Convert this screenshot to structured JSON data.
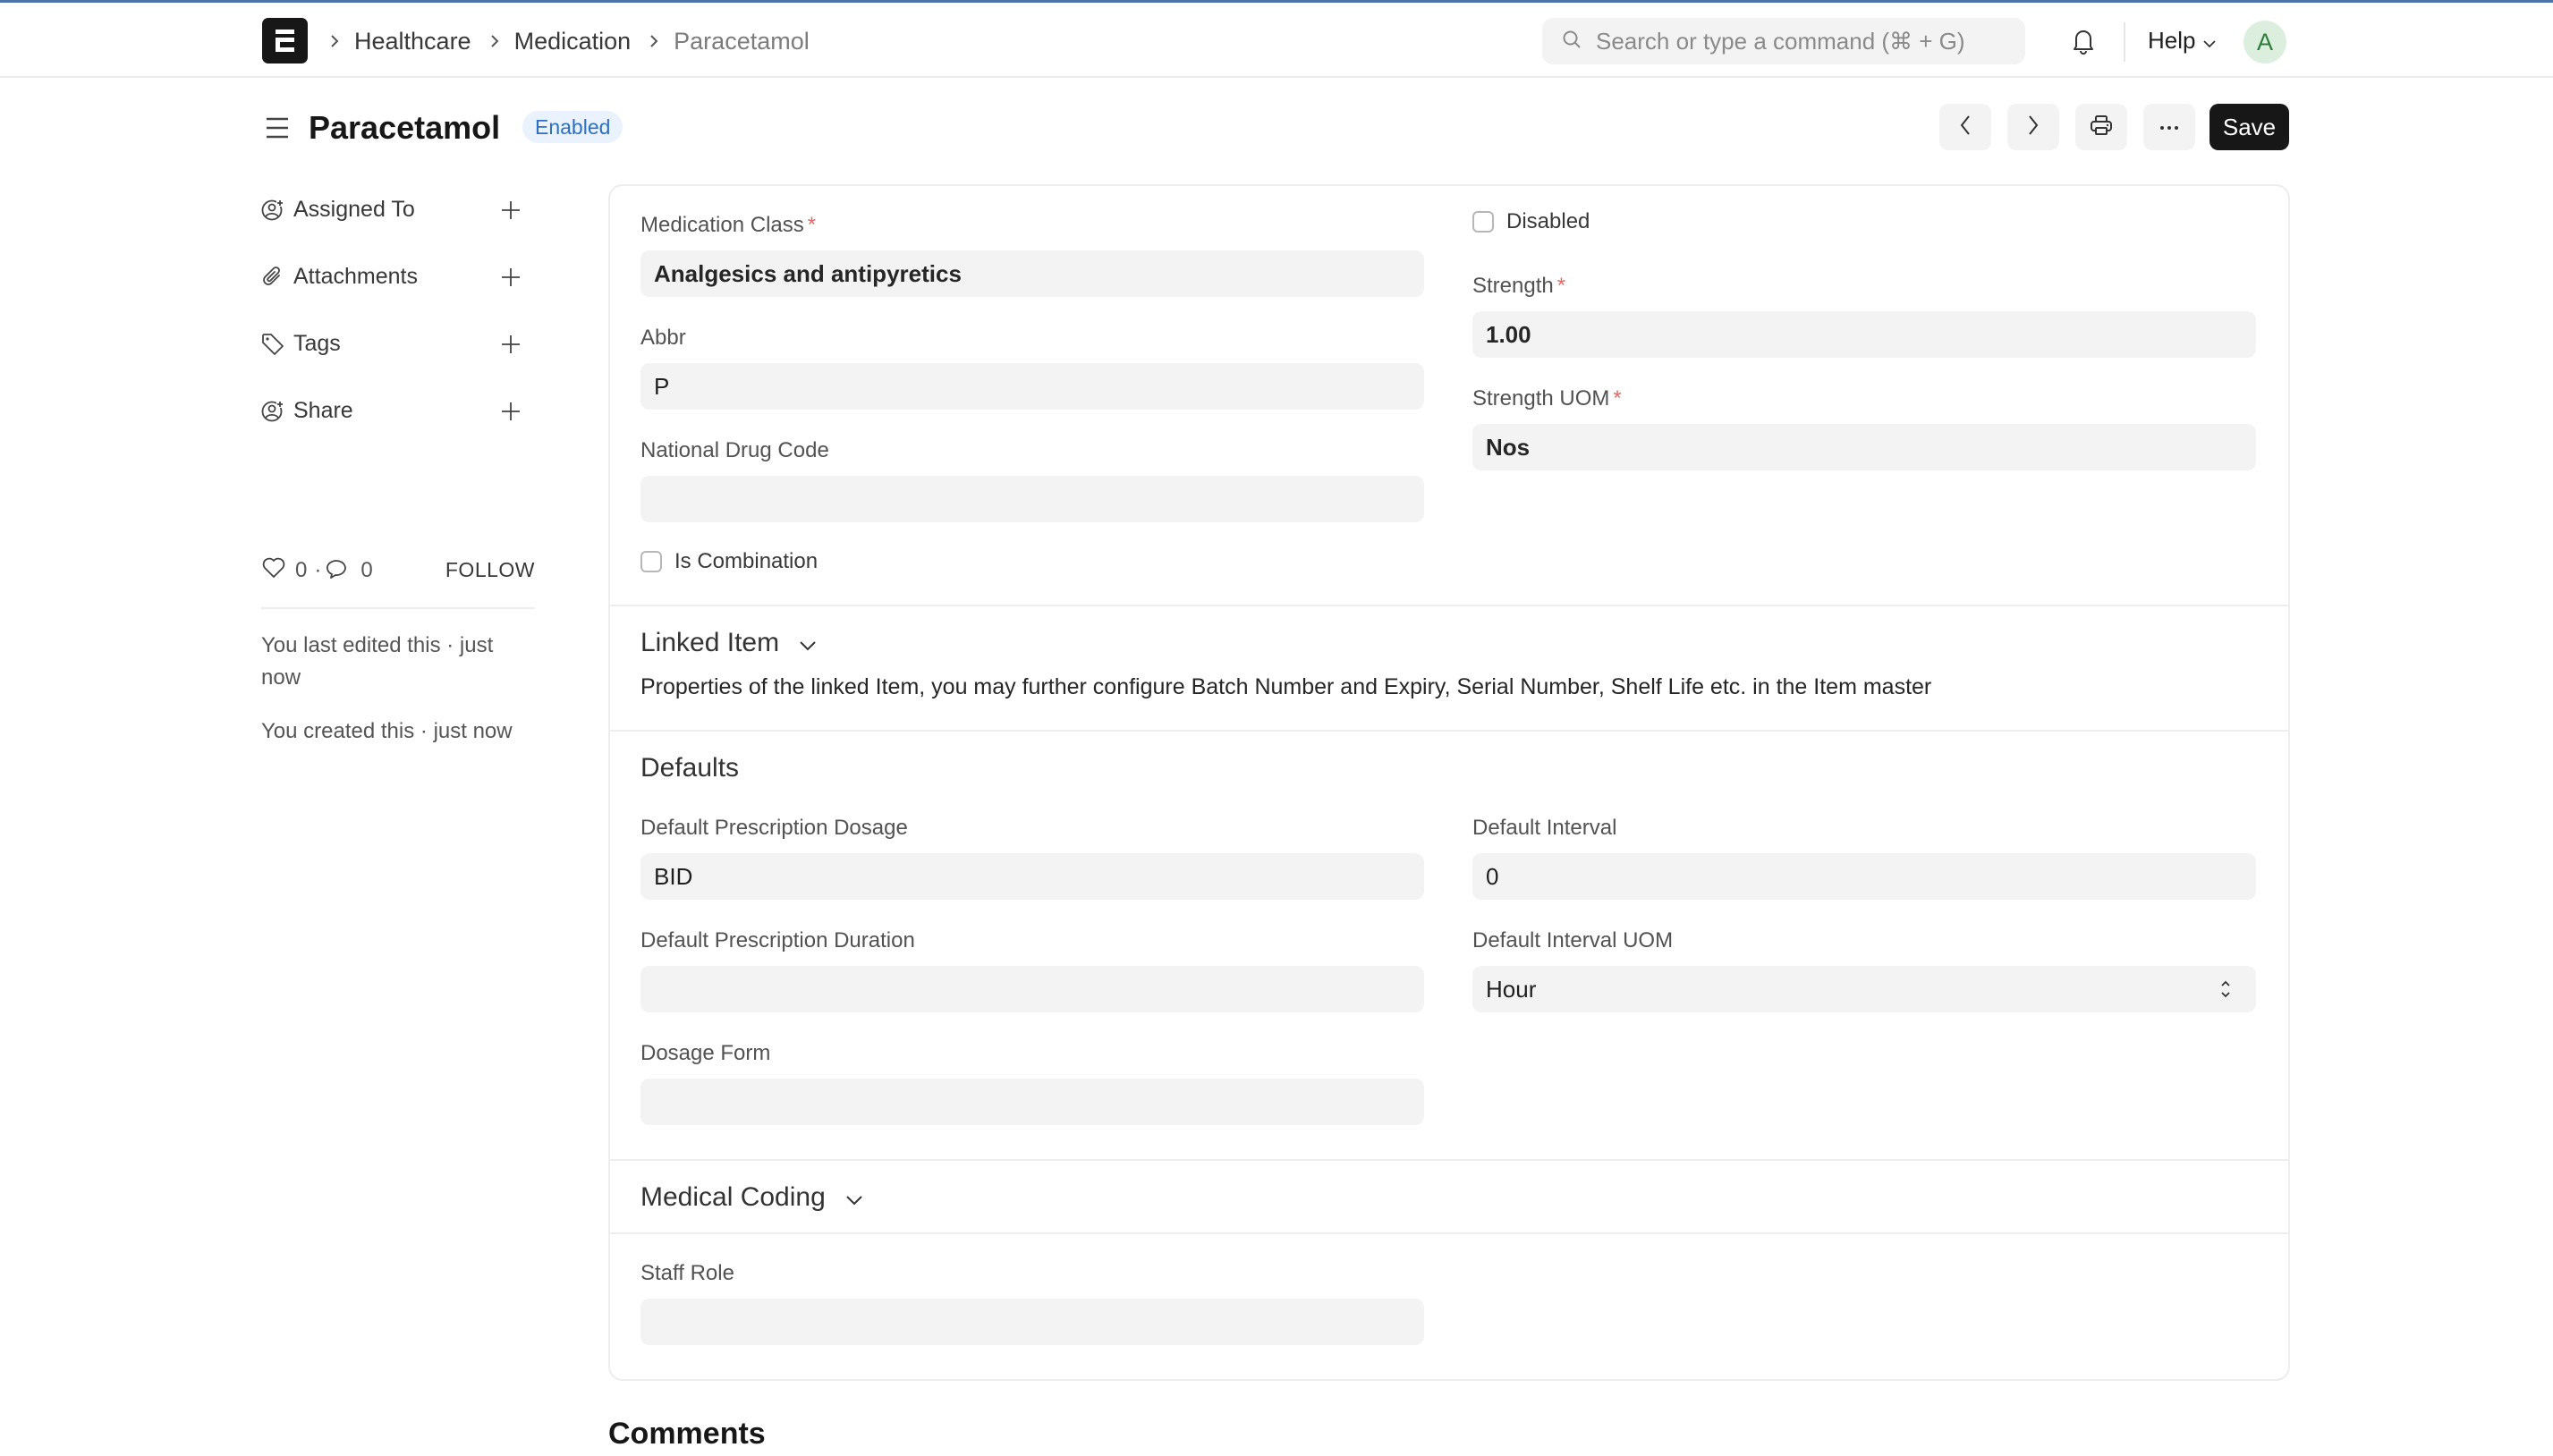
{
  "navbar": {
    "breadcrumbs": [
      "Healthcare",
      "Medication",
      "Paracetamol"
    ],
    "search_placeholder": "Search or type a command (⌘ + G)",
    "help_label": "Help",
    "avatar_initial": "A"
  },
  "header": {
    "title": "Paracetamol",
    "status_badge": "Enabled",
    "save_label": "Save"
  },
  "sidebar": {
    "items": [
      {
        "label": "Assigned To",
        "icon": "user-plus-icon"
      },
      {
        "label": "Attachments",
        "icon": "paperclip-icon"
      },
      {
        "label": "Tags",
        "icon": "tag-icon"
      },
      {
        "label": "Share",
        "icon": "user-plus-icon"
      }
    ],
    "likes": "0",
    "comments_count": "0",
    "separator": "·",
    "follow_label": "FOLLOW",
    "activity": [
      "You last edited this · just now",
      "You created this · just now"
    ]
  },
  "form": {
    "medication_class": {
      "label": "Medication Class",
      "value": "Analgesics and antipyretics",
      "required": "*"
    },
    "abbr": {
      "label": "Abbr",
      "value": "P"
    },
    "national_drug_code": {
      "label": "National Drug Code",
      "value": ""
    },
    "is_combination": {
      "label": "Is Combination",
      "checked": false
    },
    "disabled": {
      "label": "Disabled",
      "checked": false
    },
    "strength": {
      "label": "Strength",
      "value": "1.00",
      "required": "*"
    },
    "strength_uom": {
      "label": "Strength UOM",
      "value": "Nos",
      "required": "*"
    },
    "linked_item": {
      "title": "Linked Item",
      "description": "Properties of the linked Item, you may further configure Batch Number and Expiry, Serial Number, Shelf Life etc. in the Item master"
    },
    "defaults": {
      "title": "Defaults",
      "default_prescription_dosage": {
        "label": "Default Prescription Dosage",
        "value": "BID"
      },
      "default_prescription_duration": {
        "label": "Default Prescription Duration",
        "value": ""
      },
      "dosage_form": {
        "label": "Dosage Form",
        "value": ""
      },
      "default_interval": {
        "label": "Default Interval",
        "value": "0"
      },
      "default_interval_uom": {
        "label": "Default Interval UOM",
        "value": "Hour"
      }
    },
    "medical_coding": {
      "title": "Medical Coding"
    },
    "staff_role": {
      "label": "Staff Role",
      "value": ""
    }
  },
  "comments": {
    "title": "Comments"
  }
}
